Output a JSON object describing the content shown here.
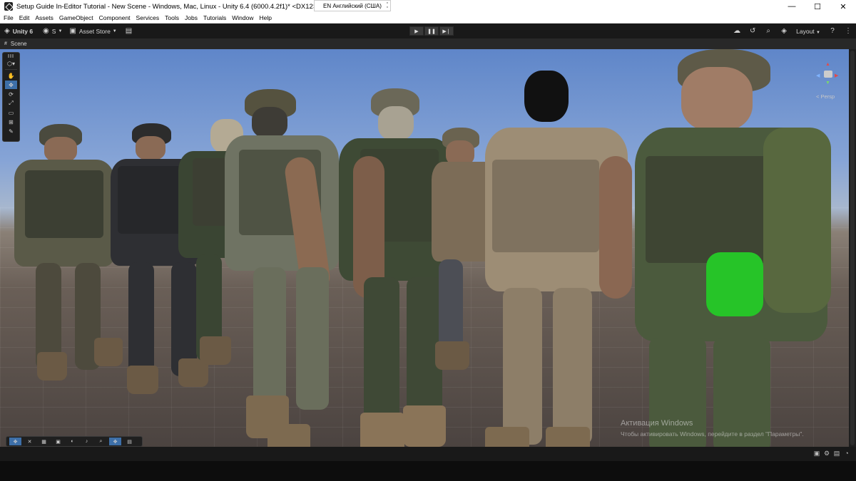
{
  "window": {
    "title": "Setup Guide In-Editor Tutorial - New Scene - Windows, Mac, Linux - Unity 6.4 (6000.4.2f1)* <DX12>",
    "language_indicator": "EN Английский (США)",
    "minimize": "—",
    "maximize": "☐",
    "close": "✕"
  },
  "menu": [
    "File",
    "Edit",
    "Assets",
    "GameObject",
    "Component",
    "Services",
    "Tools",
    "Jobs",
    "Tutorials",
    "Window",
    "Help"
  ],
  "toolbar": {
    "unity_label": "Unity 6",
    "account_label": "S",
    "asset_store_label": "Asset Store",
    "layout_label": "Layout",
    "play": "▶",
    "pause": "❚❚",
    "step": "▶❘"
  },
  "scene": {
    "tab_label": "Scene",
    "gizmo_label": "< Persp"
  },
  "watermark": {
    "title": "Активация Windows",
    "subtitle": "Чтобы активировать Windows, перейдите в раздел \"Параметры\"."
  },
  "colors": {
    "editor_bg": "#191919",
    "accent": "#3d6fa8",
    "sky_top": "#5f86c9",
    "ground": "#6a5f57"
  }
}
